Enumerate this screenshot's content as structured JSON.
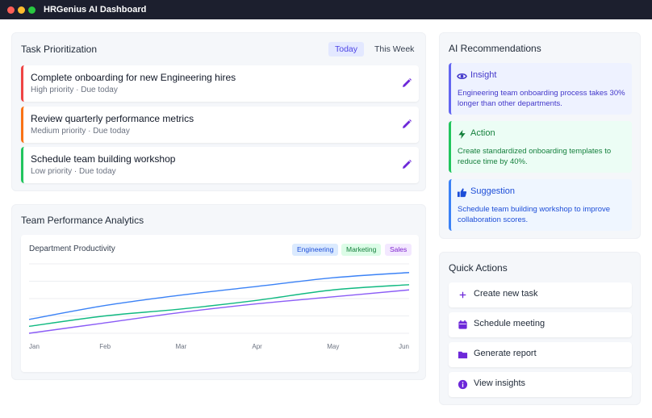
{
  "window": {
    "title": "HRGenius AI Dashboard"
  },
  "tasks": {
    "title": "Task Prioritization",
    "tabs": [
      {
        "label": "Today",
        "active": true
      },
      {
        "label": "This Week",
        "active": false
      }
    ],
    "items": [
      {
        "name": "Complete onboarding for new Engineering hires",
        "priority": "High priority",
        "due": "Due today",
        "color": "#ef4444"
      },
      {
        "name": "Review quarterly performance metrics",
        "priority": "Medium priority",
        "due": "Due today",
        "color": "#f97316"
      },
      {
        "name": "Schedule team building workshop",
        "priority": "Low priority",
        "due": "Due today",
        "color": "#22c55e"
      }
    ],
    "separator": "·",
    "edit_icon": "pencil-icon"
  },
  "analytics": {
    "title": "Team Performance Analytics",
    "chart_title": "Department Productivity",
    "legend": [
      {
        "label": "Engineering",
        "bg": "#dbeafe",
        "fg": "#1d4ed8"
      },
      {
        "label": "Marketing",
        "bg": "#dcfce7",
        "fg": "#15803d"
      },
      {
        "label": "Sales",
        "bg": "#f3e8ff",
        "fg": "#7e22ce"
      }
    ]
  },
  "chart_data": {
    "type": "line",
    "title": "Department Productivity",
    "categories": [
      "Jan",
      "Feb",
      "Mar",
      "Apr",
      "May",
      "Jun"
    ],
    "series": [
      {
        "name": "Engineering",
        "color": "#3b82f6",
        "values": [
          68,
          76,
          82,
          87,
          92,
          95
        ]
      },
      {
        "name": "Marketing",
        "color": "#10b981",
        "values": [
          64,
          70,
          74,
          79,
          85,
          88
        ]
      },
      {
        "name": "Sales",
        "color": "#8b5cf6",
        "values": [
          60,
          66,
          72,
          77,
          81,
          85
        ]
      }
    ],
    "ylim": [
      60,
      100
    ],
    "grid": true,
    "legend_position": "top-right"
  },
  "ai": {
    "title": "AI Recommendations",
    "cards": [
      {
        "heading": "Insight",
        "icon": "eye-icon",
        "body": "Engineering team onboarding process takes 30% longer than other departments.",
        "bg": "#eef2ff",
        "border": "#6366f1",
        "fg": "#4338ca"
      },
      {
        "heading": "Action",
        "icon": "lightning-icon",
        "body": "Create standardized onboarding templates to reduce time by 40%.",
        "bg": "#ecfdf5",
        "border": "#22c55e",
        "fg": "#15803d"
      },
      {
        "heading": "Suggestion",
        "icon": "thumbs-up-icon",
        "body": "Schedule team building workshop to improve collaboration scores.",
        "bg": "#eff6ff",
        "border": "#3b82f6",
        "fg": "#1d4ed8"
      }
    ]
  },
  "quick_actions": {
    "title": "Quick Actions",
    "items": [
      {
        "label": "Create new task",
        "icon": "plus-icon"
      },
      {
        "label": "Schedule meeting",
        "icon": "calendar-icon"
      },
      {
        "label": "Generate report",
        "icon": "folder-icon"
      },
      {
        "label": "View insights",
        "icon": "info-icon"
      }
    ],
    "accent": "#6d28d9"
  }
}
